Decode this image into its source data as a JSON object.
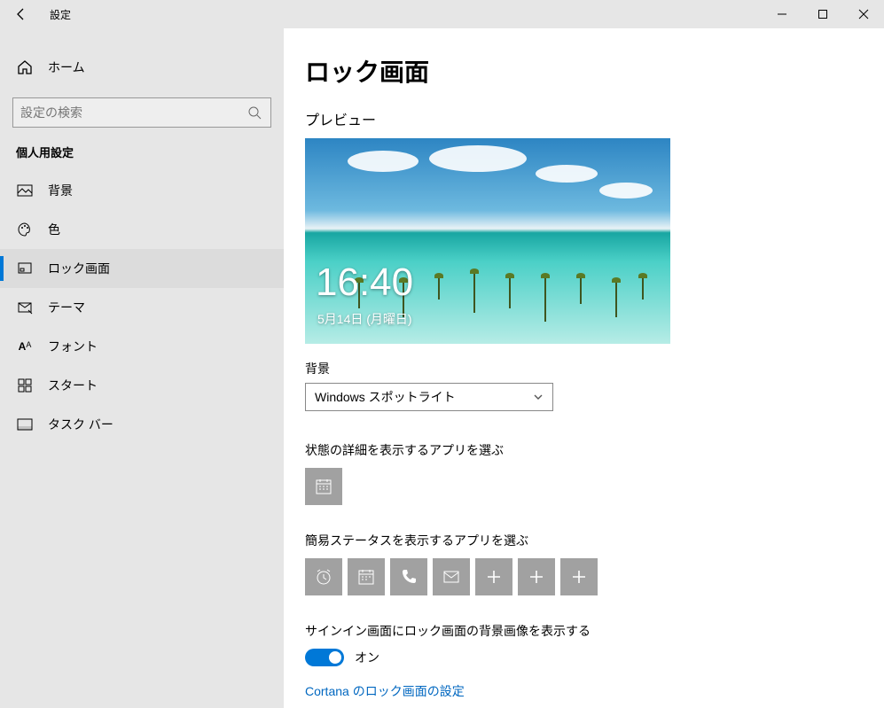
{
  "window": {
    "title": "設定"
  },
  "sidebar": {
    "home": "ホーム",
    "search_placeholder": "設定の検索",
    "section": "個人用設定",
    "items": [
      {
        "label": "背景"
      },
      {
        "label": "色"
      },
      {
        "label": "ロック画面"
      },
      {
        "label": "テーマ"
      },
      {
        "label": "フォント"
      },
      {
        "label": "スタート"
      },
      {
        "label": "タスク バー"
      }
    ],
    "active_index": 2
  },
  "main": {
    "title": "ロック画面",
    "preview_label": "プレビュー",
    "preview_time": "16:40",
    "preview_date": "5月14日 (月曜日)",
    "background_label": "背景",
    "background_value": "Windows スポットライト",
    "detailed_label": "状態の詳細を表示するアプリを選ぶ",
    "quick_label": "簡易ステータスを表示するアプリを選ぶ",
    "toggle_label": "サインイン画面にロック画面の背景画像を表示する",
    "toggle_value": "オン",
    "cortana_link": "Cortana のロック画面の設定"
  }
}
